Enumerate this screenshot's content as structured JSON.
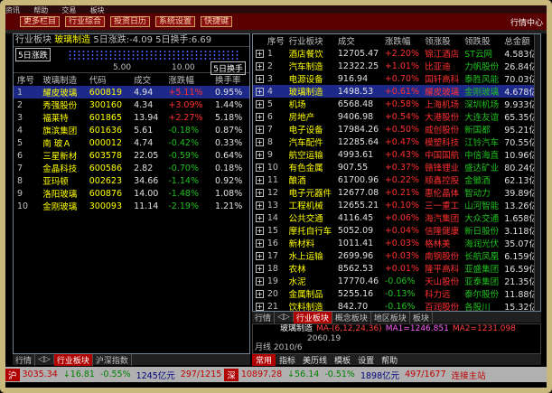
{
  "titlebar": {
    "items": [
      "资讯",
      "帮助",
      "交易",
      "板块"
    ]
  },
  "toolbar": {
    "buttons": [
      "更多栏目",
      "行业综合",
      "投资日历",
      "系统设置",
      "快捷键"
    ],
    "right": "行情中心"
  },
  "left": {
    "header": {
      "prefix": "行业板块 ",
      "name": "玻璃制造",
      "rest": " 5日涨跌:-4.09 5日换手:6.69"
    },
    "mini": {
      "tag": "5日涨跌",
      "tag2": "5日换手",
      "ax1": "5.00",
      "ax2": "10.00"
    },
    "columns": [
      "序号",
      "玻璃制造",
      "代码",
      "成交",
      "涨跌幅",
      "换手率"
    ],
    "rows": [
      [
        "1",
        "耀皮玻璃",
        "600819",
        "4.94",
        "+5.11%",
        "0.95%"
      ],
      [
        "2",
        "秀强股份",
        "300160",
        "4.34",
        "+3.09%",
        "1.44%"
      ],
      [
        "3",
        "福莱特",
        "601865",
        "13.94",
        "+2.27%",
        "5.18%"
      ],
      [
        "4",
        "旗滨集团",
        "601636",
        "5.61",
        "-0.18%",
        "0.87%"
      ],
      [
        "5",
        "南 玻Ａ",
        "000012",
        "4.74",
        "-0.42%",
        "0.33%"
      ],
      [
        "6",
        "三星新材",
        "603578",
        "22.05",
        "-0.59%",
        "0.64%"
      ],
      [
        "7",
        "金晶科技",
        "600586",
        "2.82",
        "-0.70%",
        "0.18%"
      ],
      [
        "8",
        "亚玛顿",
        "002623",
        "34.66",
        "-1.14%",
        "0.92%"
      ],
      [
        "9",
        "洛阳玻璃",
        "600876",
        "14.00",
        "-1.48%",
        "1.08%"
      ],
      [
        "10",
        "金刚玻璃",
        "300093",
        "11.14",
        "-2.19%",
        "1.21%"
      ]
    ]
  },
  "right": {
    "columns": [
      "序号",
      "行业板块",
      "成交",
      "涨跌幅",
      "领涨股",
      "领跌股",
      "总金额"
    ],
    "rows": [
      [
        "1",
        "酒店餐饮",
        "12705.47",
        "+2.20%",
        "锦江酒店",
        "ST云网",
        "4.583亿"
      ],
      [
        "2",
        "汽车制造",
        "12322.25",
        "+1.01%",
        "比亚迪",
        "力帆股份",
        "26.84亿"
      ],
      [
        "3",
        "电源设备",
        "916.94",
        "+0.70%",
        "国轩高科",
        "泰胜风能",
        "70.03亿"
      ],
      [
        "4",
        "玻璃制造",
        "1498.53",
        "+0.61%",
        "耀皮玻璃",
        "金刚玻璃",
        "4.678亿"
      ],
      [
        "5",
        "机场",
        "6568.48",
        "+0.58%",
        "上海机场",
        "深圳机场",
        "9.933亿"
      ],
      [
        "6",
        "房地产",
        "9406.98",
        "+0.54%",
        "大港股份",
        "大连友谊",
        "65.35亿"
      ],
      [
        "7",
        "电子设备",
        "17984.26",
        "+0.50%",
        "威创股份",
        "新国都",
        "95.21亿"
      ],
      [
        "8",
        "汽车配件",
        "12285.64",
        "+0.47%",
        "模塑科技",
        "江铃汽车",
        "70.55亿"
      ],
      [
        "9",
        "航空运输",
        "4993.61",
        "+0.43%",
        "中国国航",
        "中信海直",
        "10.96亿"
      ],
      [
        "10",
        "有色金属",
        "907.55",
        "+0.37%",
        "赣锋锂业",
        "盛达矿业",
        "80.24亿"
      ],
      [
        "11",
        "酿酒",
        "61700.96",
        "+0.22%",
        "顺鑫控股",
        "金徽酒",
        "62.13亿"
      ],
      [
        "12",
        "电子元器件",
        "12677.08",
        "+0.21%",
        "惠伦晶体",
        "智动力",
        "39.89亿"
      ],
      [
        "13",
        "工程机械",
        "12655.21",
        "+0.10%",
        "三一重工",
        "山河智能",
        "13.26亿"
      ],
      [
        "14",
        "公共交通",
        "4116.45",
        "+0.06%",
        "海汽集团",
        "大众交通",
        "1.658亿"
      ],
      [
        "15",
        "摩托自行车",
        "5052.09",
        "+0.04%",
        "信隆健康",
        "新日股份",
        "3.118亿"
      ],
      [
        "16",
        "新材料",
        "1011.41",
        "+0.03%",
        "格林美",
        "海润光伏",
        "35.07亿"
      ],
      [
        "17",
        "水上运输",
        "2699.96",
        "+0.03%",
        "南钢股份",
        "长航凤凰",
        "6.159亿"
      ],
      [
        "18",
        "农林",
        "8562.53",
        "+0.01%",
        "隆平高科",
        "亚盛集团",
        "16.59亿"
      ],
      [
        "19",
        "水泥",
        "17770.46",
        "-0.06%",
        "天山股份",
        "亚泰集团",
        "21.35亿"
      ],
      [
        "20",
        "金属制品",
        "5255.16",
        "-0.13%",
        "科力远",
        "泰尔股份",
        "11.88亿"
      ],
      [
        "21",
        "饮料制造",
        "842.70",
        "-0.16%",
        "百润股份",
        "各股川",
        "15.32亿"
      ],
      [
        "22",
        "塑料",
        "707.95",
        "-0.21%",
        "永高股份",
        "银禧科技",
        "15.23亿"
      ]
    ]
  },
  "right_tabs": [
    "行业板块",
    "概念板块",
    "地区板块",
    "板块"
  ],
  "kline": {
    "title": "玻璃制造",
    "ma1": "MA1=1246.851",
    "ma2": "MA2=1231.098",
    "params": "MA-(6,12,24,36)",
    "value": "2060.19",
    "date": "2010/6",
    "label": "月线"
  },
  "left_tabs": [
    "行业板块",
    "沪深指数"
  ],
  "menubar": [
    "常用",
    "指标",
    "美历线",
    "模板",
    "设置",
    "帮助"
  ],
  "status": {
    "market": "沪",
    "idx1": "3035.34",
    "chg1": "↓16.81",
    "pct1": "-0.55%",
    "amt1": "1245亿元",
    "cnt1": "297/1215",
    "market2": "深",
    "idx2": "10897.28",
    "chg2": "↓56.14",
    "pct2": "-0.51%",
    "amt2": "1898亿元",
    "cnt2": "497/1677",
    "conn": "连接主站"
  }
}
